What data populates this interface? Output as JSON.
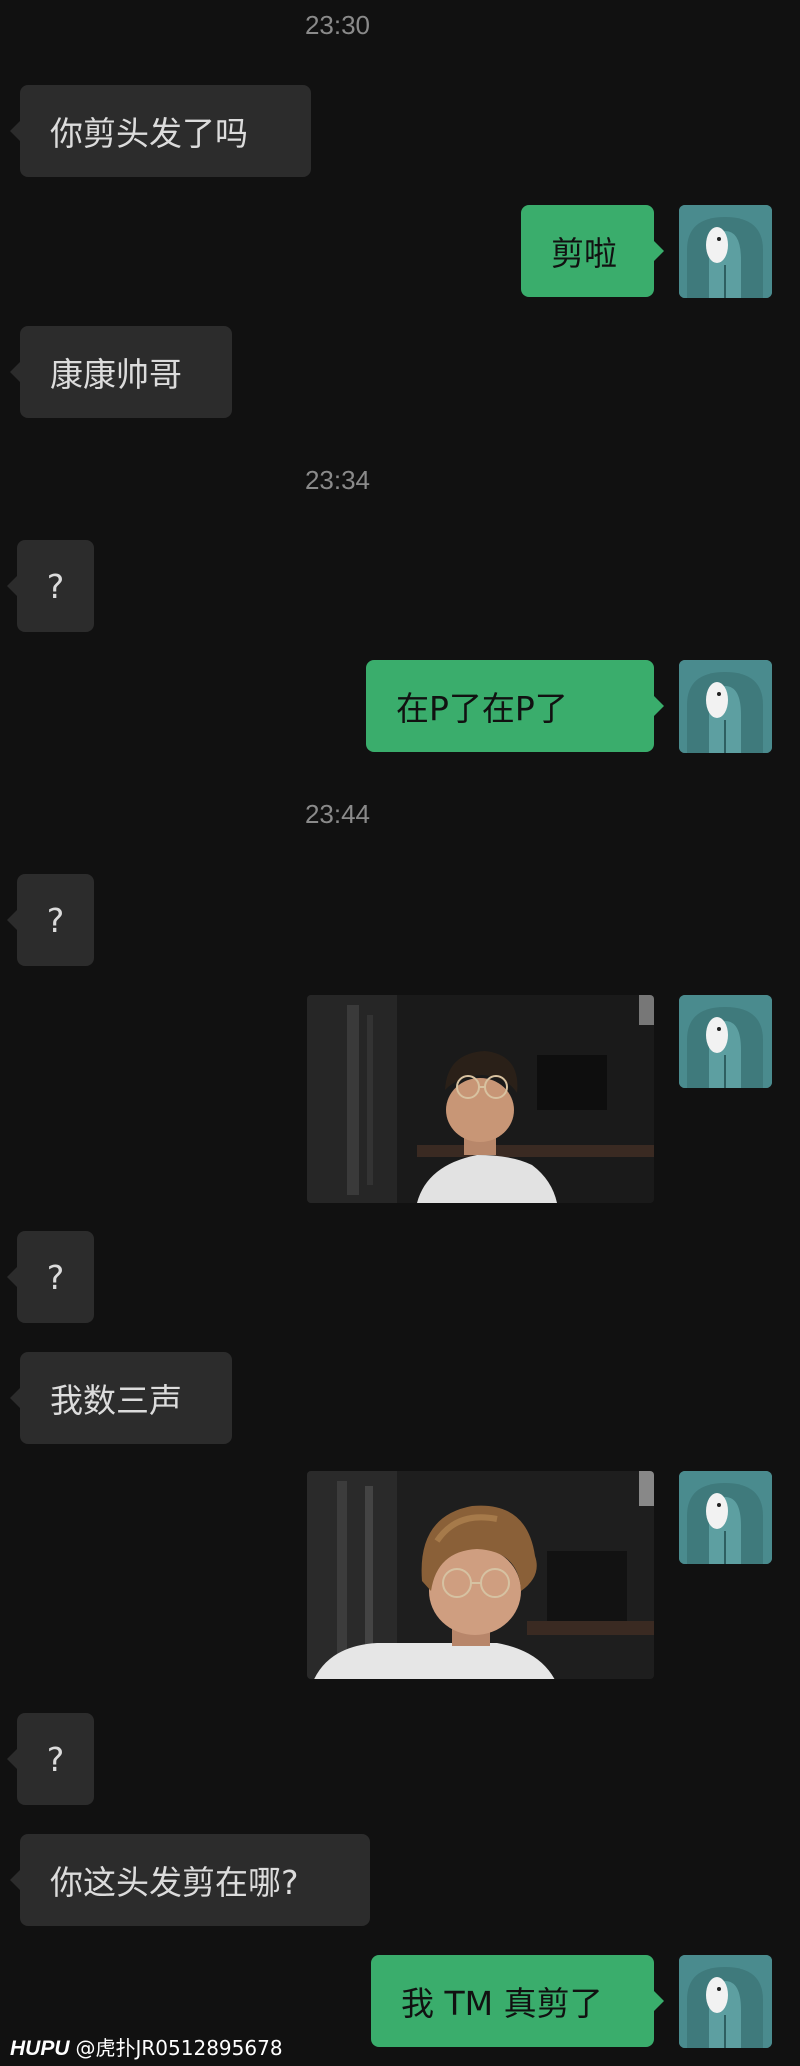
{
  "chat": {
    "timestamps": [
      "23:30",
      "23:34",
      "23:44"
    ],
    "messages": [
      {
        "side": "in",
        "text": "你剪头发了吗"
      },
      {
        "side": "out",
        "text": "剪啦"
      },
      {
        "side": "in",
        "text": "康康帅哥"
      },
      {
        "side": "in",
        "text": "?"
      },
      {
        "side": "out",
        "text": "在P了在P了"
      },
      {
        "side": "in",
        "text": "?"
      },
      {
        "side": "out",
        "type": "photo",
        "icon": "selfie-photo-1"
      },
      {
        "side": "in",
        "text": "?"
      },
      {
        "side": "in",
        "text": "我数三声"
      },
      {
        "side": "out",
        "type": "photo",
        "icon": "selfie-photo-2"
      },
      {
        "side": "in",
        "text": "?"
      },
      {
        "side": "in",
        "text": "你这头发剪在哪?"
      },
      {
        "side": "out",
        "text": "我 TM 真剪了"
      }
    ],
    "avatar_icon": "bear-hoodie-avatar-icon"
  },
  "watermark": {
    "logo": "HUPU",
    "user": "@虎扑JR0512895678"
  },
  "colors": {
    "background": "#111111",
    "incoming_bubble": "#2c2c2c",
    "outgoing_bubble": "#3aad6c",
    "timestamp": "#8a8a8a",
    "avatar": "#4a8b8e"
  }
}
